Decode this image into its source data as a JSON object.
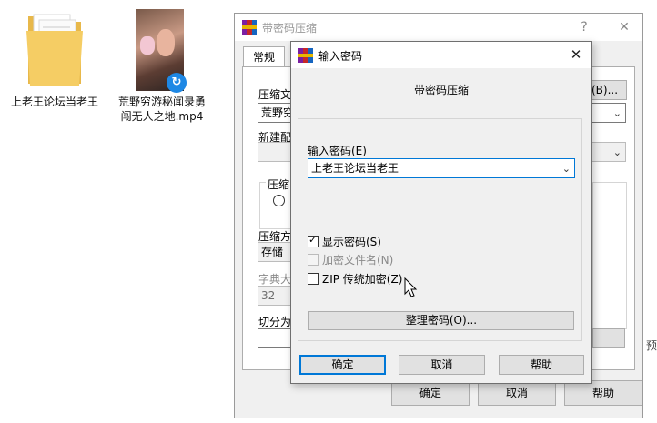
{
  "desktop": {
    "icons": [
      {
        "label": "上老王论坛当老王",
        "icon": "folder-icon"
      },
      {
        "label": "荒野穷游秘闻录勇闯无人之地.mp4",
        "icon": "video-thumbnail"
      }
    ]
  },
  "back_window": {
    "title": "带密码压缩",
    "help_symbol": "?",
    "close_symbol": "✕",
    "tab": "常规",
    "labels": {
      "archive_name": "压缩文",
      "archive_name_value": "荒野穷",
      "update_mode": "新建配",
      "archive_format": "压缩",
      "compression_method": "压缩方",
      "compression_value": "存储",
      "dict_size": "字典大",
      "dict_value": "32",
      "split": "切分为",
      "browse": "(B)...",
      "side_text": "预"
    },
    "buttons": {
      "ok": "确定",
      "cancel": "取消",
      "help": "帮助"
    }
  },
  "dialog": {
    "title": "输入密码",
    "close_symbol": "✕",
    "heading": "带密码压缩",
    "password_label": "输入密码(E)",
    "password_value": "上老王论坛当老王",
    "show_password": {
      "label": "显示密码(S)",
      "checked": true
    },
    "encrypt_names": {
      "label": "加密文件名(N)",
      "checked": false,
      "disabled": true
    },
    "zip_legacy": {
      "label": "ZIP 传统加密(Z)",
      "checked": false
    },
    "organize_button": "整理密码(O)...",
    "buttons": {
      "ok": "确定",
      "cancel": "取消",
      "help": "帮助"
    }
  }
}
